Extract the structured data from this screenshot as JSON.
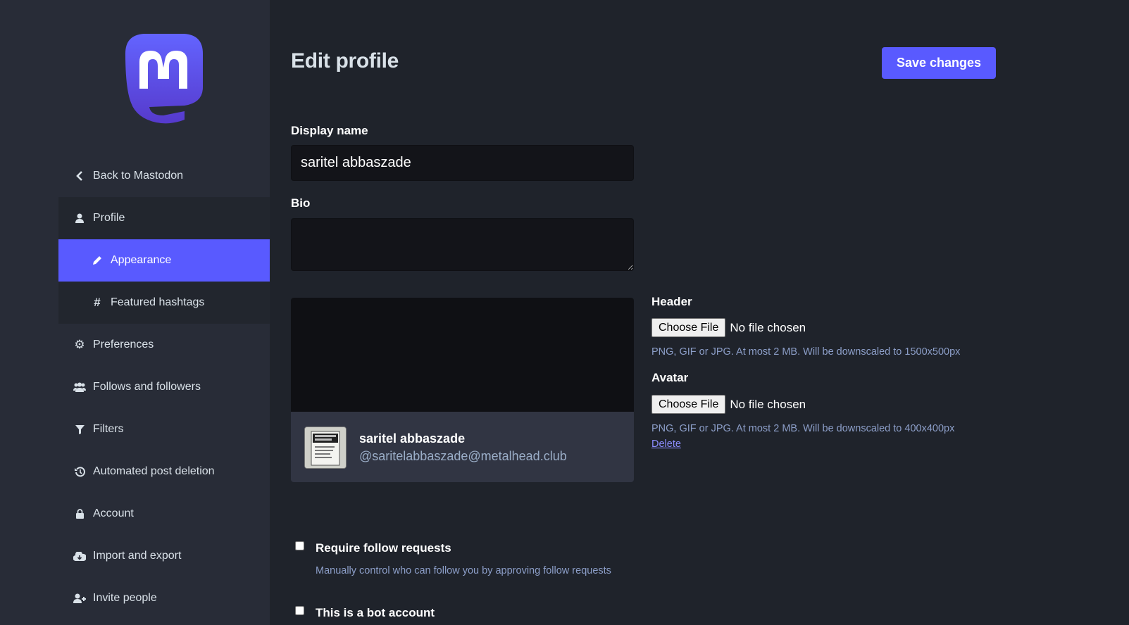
{
  "sidebar": {
    "back": "Back to Mastodon",
    "profile": "Profile",
    "appearance": "Appearance",
    "featured_hashtags": "Featured hashtags",
    "preferences": "Preferences",
    "follows": "Follows and followers",
    "filters": "Filters",
    "automated_deletion": "Automated post deletion",
    "account": "Account",
    "import_export": "Import and export",
    "invite": "Invite people"
  },
  "main": {
    "title": "Edit profile",
    "save_label": "Save changes",
    "display_name_label": "Display name",
    "display_name_value": "saritel abbaszade",
    "bio_label": "Bio",
    "bio_value": "",
    "preview_name": "saritel abbaszade",
    "preview_handle": "@saritelabbaszade@metalhead.club",
    "header_label": "Header",
    "header_button": "Choose File",
    "header_status": "No file chosen",
    "header_hint": "PNG, GIF or JPG. At most 2 MB. Will be downscaled to 1500x500px",
    "avatar_label": "Avatar",
    "avatar_button": "Choose File",
    "avatar_status": "No file chosen",
    "avatar_hint": "PNG, GIF or JPG. At most 2 MB. Will be downscaled to 400x400px",
    "avatar_delete": "Delete",
    "require_follow_label": "Require follow requests",
    "require_follow_hint": "Manually control who can follow you by approving follow requests",
    "require_follow_checked": false,
    "bot_label": "This is a bot account",
    "bot_checked": false
  },
  "colors": {
    "accent": "#595aff",
    "sidebar_bg": "#282c37",
    "main_bg": "#1f232b",
    "hint": "#8c9ec8"
  }
}
